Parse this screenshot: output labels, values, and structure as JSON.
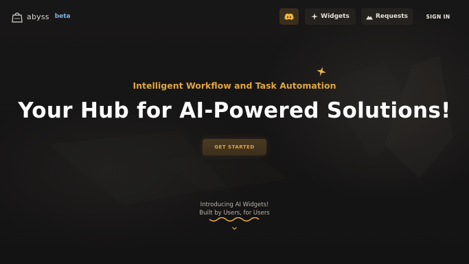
{
  "brand": {
    "name": "abyss",
    "badge": "beta"
  },
  "nav": {
    "discord_icon": "discord-icon",
    "widgets_label": "Widgets",
    "requests_label": "Requests",
    "sign_in_label": "SIGN IN"
  },
  "hero": {
    "subtitle": "Intelligent Workflow and Task Automation",
    "title": "Your Hub for AI-Powered Solutions!",
    "cta_label": "GET STARTED"
  },
  "intro": {
    "line1": "Introducing AI Widgets!",
    "line2": "Built by Users, for Users"
  },
  "colors": {
    "accent": "#e0a642",
    "background": "#151414",
    "beta": "#7fb2e5"
  }
}
